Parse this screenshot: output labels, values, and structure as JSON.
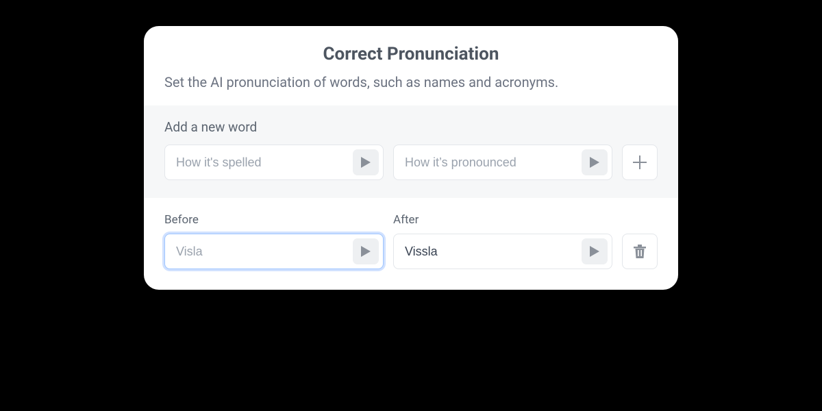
{
  "title": "Correct Pronunciation",
  "subtitle": "Set the AI pronunciation of words, such as names and acronyms.",
  "add": {
    "heading": "Add a new word",
    "spelled_placeholder": "How it's spelled",
    "pronounced_placeholder": "How it’s pronounced"
  },
  "labels": {
    "before": "Before",
    "after": "After"
  },
  "entry": {
    "before_value": "Visla",
    "after_value": "Vissla"
  }
}
